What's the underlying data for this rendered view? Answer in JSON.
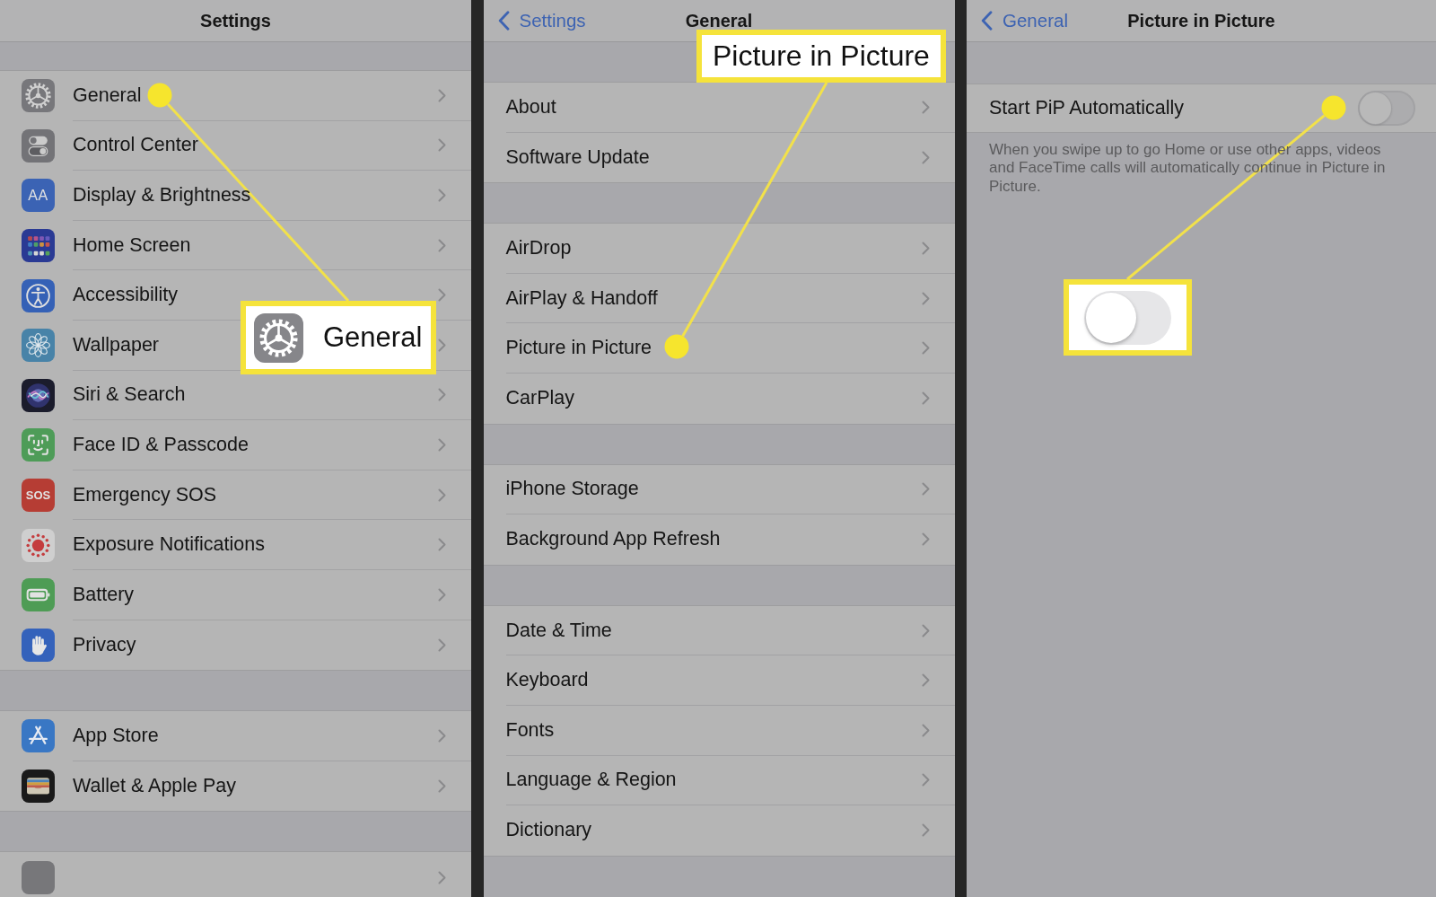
{
  "panels": [
    {
      "nav": {
        "title": "Settings"
      },
      "groups": [
        {
          "rows": [
            {
              "kind": "app",
              "label": "General"
            },
            {
              "kind": "app",
              "label": "Control Center"
            },
            {
              "kind": "app",
              "label": "Display & Brightness",
              "icon_text": "AA"
            },
            {
              "kind": "app",
              "label": "Home Screen"
            },
            {
              "kind": "app",
              "label": "Accessibility"
            },
            {
              "kind": "app",
              "label": "Wallpaper"
            },
            {
              "kind": "app",
              "label": "Siri & Search"
            },
            {
              "kind": "app",
              "label": "Face ID & Passcode"
            },
            {
              "kind": "app",
              "label": "Emergency SOS",
              "icon_text": "SOS"
            },
            {
              "kind": "app",
              "label": "Exposure Notifications"
            },
            {
              "kind": "app",
              "label": "Battery"
            },
            {
              "kind": "app",
              "label": "Privacy"
            }
          ]
        },
        {
          "rows": [
            {
              "kind": "app",
              "label": "App Store"
            },
            {
              "kind": "app",
              "label": "Wallet & Apple Pay"
            }
          ]
        },
        {
          "rows": [
            {
              "kind": "app"
            }
          ]
        }
      ]
    },
    {
      "nav": {
        "back": "Settings",
        "title": "General"
      },
      "groups": [
        {
          "rows": [
            {
              "kind": "link",
              "label": "About"
            },
            {
              "kind": "link",
              "label": "Software Update"
            }
          ]
        },
        {
          "rows": [
            {
              "kind": "link",
              "label": "AirDrop"
            },
            {
              "kind": "link",
              "label": "AirPlay & Handoff"
            },
            {
              "kind": "link",
              "label": "Picture in Picture"
            },
            {
              "kind": "link",
              "label": "CarPlay"
            }
          ]
        },
        {
          "rows": [
            {
              "kind": "link",
              "label": "iPhone Storage"
            },
            {
              "kind": "link",
              "label": "Background App Refresh"
            }
          ]
        },
        {
          "rows": [
            {
              "kind": "link",
              "label": "Date & Time"
            },
            {
              "kind": "link",
              "label": "Keyboard"
            },
            {
              "kind": "link",
              "label": "Fonts"
            },
            {
              "kind": "link",
              "label": "Language & Region"
            },
            {
              "kind": "link",
              "label": "Dictionary"
            }
          ]
        }
      ]
    },
    {
      "nav": {
        "back": "General",
        "title": "Picture in Picture"
      },
      "groups": [
        {
          "rows": [
            {
              "kind": "toggle",
              "label": "Start PiP Automatically",
              "on": false
            }
          ],
          "footer": "When you swipe up to go Home or use other apps, videos and FaceTime calls will automatically continue in Picture in Picture."
        }
      ]
    }
  ],
  "callouts": [
    {
      "kind": "icon-label",
      "text": "General"
    },
    {
      "kind": "label",
      "text": "Picture in Picture"
    },
    {
      "kind": "toggle",
      "on": false
    }
  ]
}
